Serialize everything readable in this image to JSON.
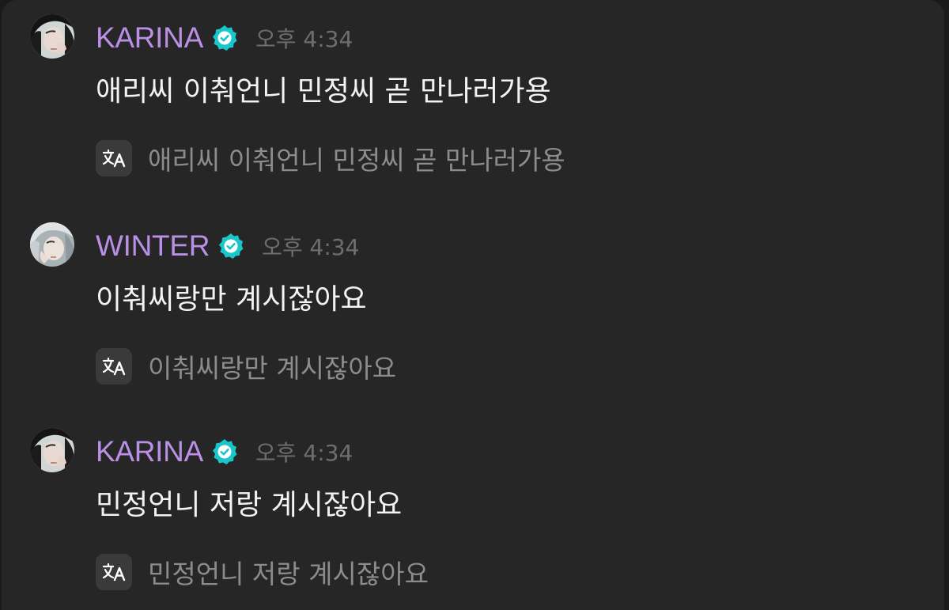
{
  "colors": {
    "background": "#262626",
    "username": "#b990e6",
    "verified_badge": "#19c6c9",
    "message_text": "#f3f3f3",
    "timestamp": "#6e6e6e",
    "translation_text": "#8c8c8c"
  },
  "messages": [
    {
      "username": "KARINA",
      "verified": true,
      "timestamp": "오후 4:34",
      "text": "애리씨 이춰언니 민정씨 곧 만나러가용",
      "translation_icon": "translate-icon",
      "translation": "애리씨 이춰언니 민정씨 곧 만나러가용"
    },
    {
      "username": "WINTER",
      "verified": true,
      "timestamp": "오후 4:34",
      "text": "이춰씨랑만 계시잖아요",
      "translation_icon": "translate-icon",
      "translation": "이춰씨랑만 계시잖아요"
    },
    {
      "username": "KARINA",
      "verified": true,
      "timestamp": "오후 4:34",
      "text": "민정언니 저랑 계시잖아요",
      "translation_icon": "translate-icon",
      "translation": "민정언니 저랑 계시잖아요"
    }
  ]
}
